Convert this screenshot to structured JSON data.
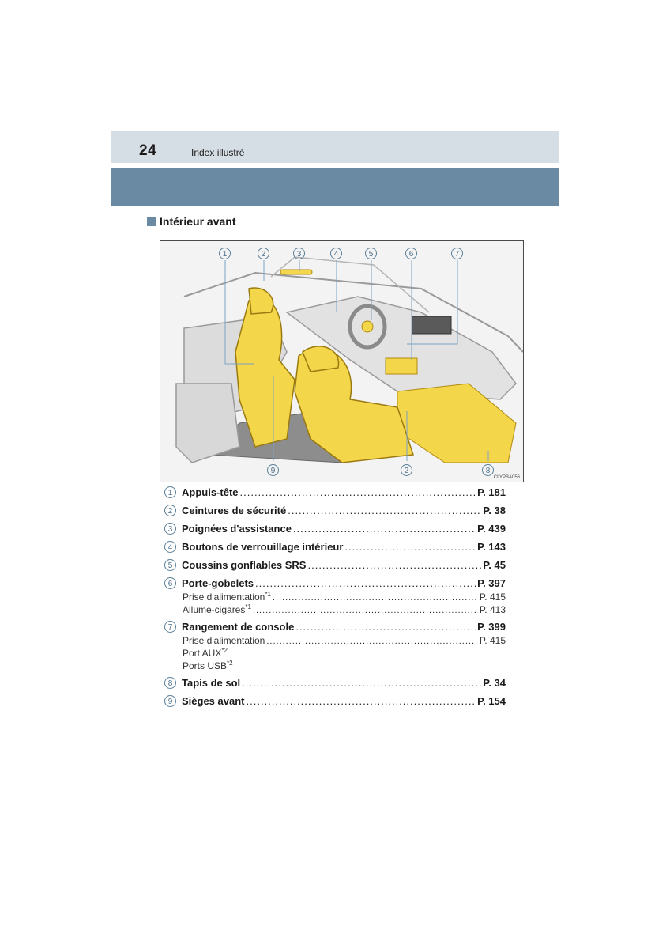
{
  "header": {
    "page_number": "24",
    "section_title": "Index illustré"
  },
  "sub_heading": "Intérieur avant",
  "illustration": {
    "image_code": "CLYPBA056",
    "callouts": [
      "1",
      "2",
      "3",
      "4",
      "5",
      "6",
      "7",
      "2",
      "8",
      "9"
    ],
    "highlight_color": "#f4d64a"
  },
  "items": [
    {
      "num": "1",
      "label": "Appuis-tête",
      "page": "P. 181",
      "subs": []
    },
    {
      "num": "2",
      "label": "Ceintures de sécurité",
      "page": "P. 38",
      "subs": []
    },
    {
      "num": "3",
      "label": "Poignées d'assistance",
      "page": "P. 439",
      "subs": []
    },
    {
      "num": "4",
      "label": "Boutons de verrouillage intérieur",
      "page": "P. 143",
      "subs": []
    },
    {
      "num": "5",
      "label": "Coussins gonflables SRS",
      "page": "P. 45",
      "subs": []
    },
    {
      "num": "6",
      "label": "Porte-gobelets",
      "page": "P. 397",
      "subs": [
        {
          "label": "Prise d'alimentation",
          "sup": "*1",
          "page": "P. 415"
        },
        {
          "label": "Allume-cigares",
          "sup": "*1",
          "page": "P. 413"
        }
      ]
    },
    {
      "num": "7",
      "label": "Rangement de console",
      "page": "P. 399",
      "subs": [
        {
          "label": "Prise d'alimentation",
          "sup": "",
          "page": "P. 415"
        },
        {
          "label": "Port AUX",
          "sup": "*2",
          "page": ""
        },
        {
          "label": "Ports USB",
          "sup": "*2",
          "page": ""
        }
      ]
    },
    {
      "num": "8",
      "label": "Tapis de sol",
      "page": "P. 34",
      "subs": []
    },
    {
      "num": "9",
      "label": "Sièges avant",
      "page": "P. 154",
      "subs": []
    }
  ]
}
